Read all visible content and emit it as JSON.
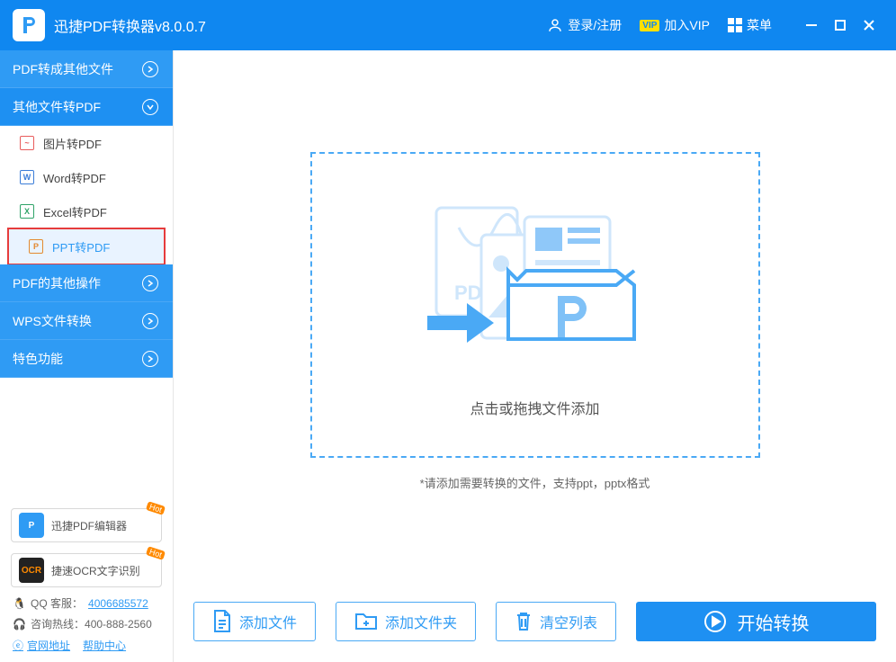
{
  "app": {
    "title": "迅捷PDF转换器v8.0.0.7"
  },
  "titlebar": {
    "login": "登录/注册",
    "vip": "加入VIP",
    "menu": "菜单"
  },
  "sidebar": {
    "categories": [
      {
        "label": "PDF转成其他文件",
        "expanded": false
      },
      {
        "label": "其他文件转PDF",
        "expanded": true
      },
      {
        "label": "PDF的其他操作",
        "expanded": false
      },
      {
        "label": "WPS文件转换",
        "expanded": false
      },
      {
        "label": "特色功能",
        "expanded": false
      }
    ],
    "subitems": [
      {
        "label": "图片转PDF",
        "color": "#e85c5c",
        "glyph": "~"
      },
      {
        "label": "Word转PDF",
        "color": "#3b7dd8",
        "glyph": "W"
      },
      {
        "label": "Excel转PDF",
        "color": "#2fa368",
        "glyph": "X"
      },
      {
        "label": "PPT转PDF",
        "color": "#e38a2f",
        "glyph": "P"
      }
    ],
    "promos": [
      {
        "label": "迅捷PDF编辑器",
        "badge": "Hot",
        "bg": "#2f9bf4",
        "ico": "P"
      },
      {
        "label": "捷速OCR文字识别",
        "badge": "Hot",
        "bg": "#222",
        "ico": "OCR"
      }
    ],
    "contact": {
      "qq_label": "QQ 客服：",
      "qq_value": "4006685572",
      "phone_label": "咨询热线：",
      "phone_value": "400-888-2560",
      "site_label": "官网地址",
      "help_label": "帮助中心"
    }
  },
  "main": {
    "drop_label": "点击或拖拽文件添加",
    "hint": "*请添加需要转换的文件，支持ppt，pptx格式"
  },
  "actions": {
    "add_file": "添加文件",
    "add_folder": "添加文件夹",
    "clear": "清空列表",
    "start": "开始转换"
  }
}
